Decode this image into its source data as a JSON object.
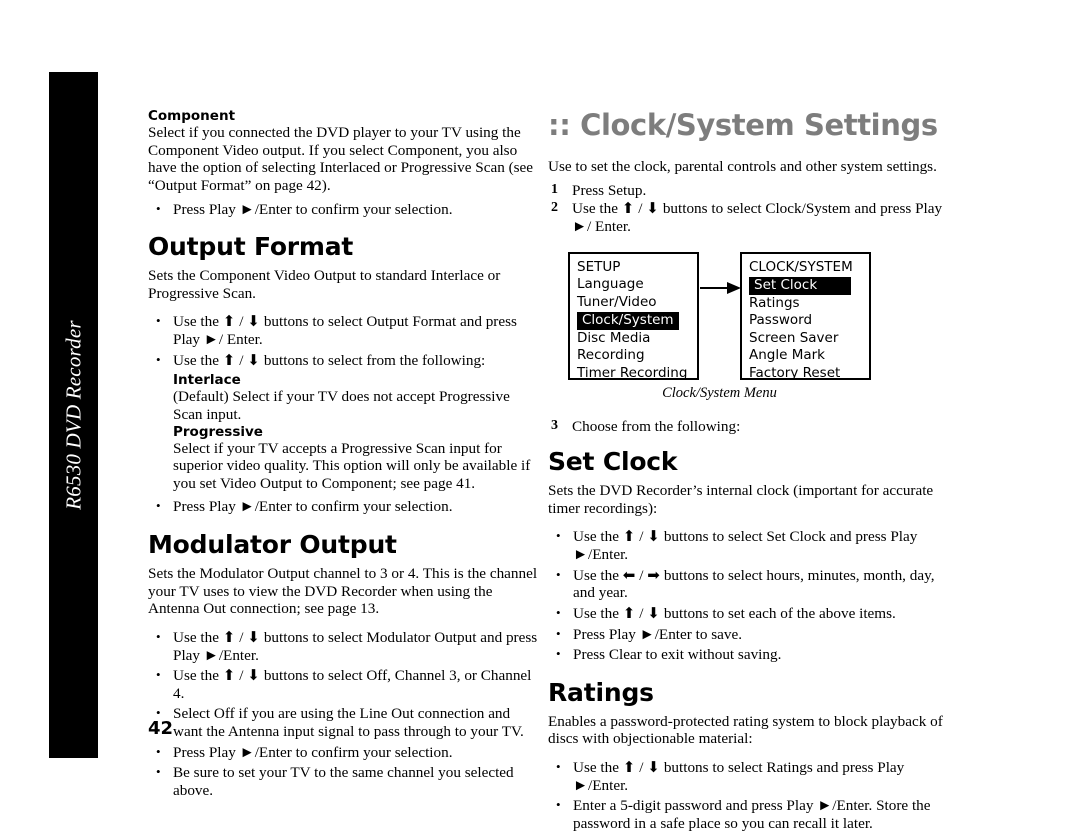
{
  "spine": {
    "label": "R6530 DVD Recorder"
  },
  "page_number": "42",
  "left_column": {
    "component": {
      "heading": "Component",
      "body": "Select if you connected the DVD player to your TV using the Component Video output. If you select Component, you also have the option of selecting Interlaced or Progressive Scan (see “Output Format” on page 42).",
      "bullets": [
        "Press Play ►/Enter to confirm your selection."
      ]
    },
    "output_format": {
      "heading": "Output Format",
      "body": "Sets the Component Video Output to standard Interlace or Progressive Scan.",
      "bullets": [
        "Use the ⬆ / ⬇ buttons to select Output Format and press Play ►/ Enter.",
        "Use the ⬆ / ⬇ buttons to select from the following:"
      ],
      "interlace": {
        "heading": "Interlace",
        "body": "(Default) Select if your TV does not accept Progressive Scan input."
      },
      "progressive": {
        "heading": "Progressive",
        "body": "Select if your TV accepts a Progressive Scan input for superior video quality. This option will only be available if you set Video Output to Component; see page 41."
      },
      "final_bullets": [
        "Press Play ►/Enter to confirm your selection."
      ]
    },
    "modulator_output": {
      "heading": "Modulator Output",
      "body": "Sets the Modulator Output channel to 3 or 4. This is the channel your TV uses to view the DVD Recorder when using the Antenna Out connection; see page 13.",
      "bullets": [
        "Use the ⬆ / ⬇ buttons to select Modulator Output and press Play ►/Enter.",
        "Use the ⬆ / ⬇ buttons to select Off, Channel 3, or Channel 4.",
        "Select Off if you are using the Line Out connection and  want the Antenna input signal to pass through to your TV.",
        "Press Play ►/Enter to confirm your selection.",
        "Be sure to set your TV to the same channel you selected above."
      ]
    }
  },
  "right_column": {
    "title_prefix": ":: ",
    "title": ":: Clock/System Settings",
    "intro": "Use to set the clock, parental controls and other system settings.",
    "steps": [
      {
        "num": "1",
        "text": "Press Setup."
      },
      {
        "num": "2",
        "text": "Use the ⬆ / ⬇ buttons to select Clock/System and press Play ►/ Enter."
      }
    ],
    "diagram": {
      "setup_menu": {
        "title": "SETUP",
        "items": [
          {
            "label": "Language",
            "selected": false
          },
          {
            "label": "Tuner/Video",
            "selected": false
          },
          {
            "label": "Clock/System",
            "selected": true
          },
          {
            "label": "Disc Media",
            "selected": false
          },
          {
            "label": "Recording",
            "selected": false
          },
          {
            "label": "Timer Recording",
            "selected": false
          }
        ]
      },
      "clock_system_menu": {
        "title": "CLOCK/SYSTEM",
        "items": [
          {
            "label": "Set Clock",
            "selected": true
          },
          {
            "label": "Ratings",
            "selected": false
          },
          {
            "label": "Password",
            "selected": false
          },
          {
            "label": "Screen Saver",
            "selected": false
          },
          {
            "label": "Angle Mark",
            "selected": false
          },
          {
            "label": "Factory Reset",
            "selected": false
          }
        ]
      },
      "caption": "Clock/System Menu"
    },
    "step3": {
      "num": "3",
      "text": "Choose from the following:"
    },
    "set_clock": {
      "heading": "Set Clock",
      "body": "Sets the DVD Recorder’s internal clock (important for accurate timer recordings):",
      "bullets": [
        "Use the ⬆ / ⬇ buttons to select Set Clock and press Play ►/Enter.",
        "Use the ⬅ / ➡ buttons to select hours, minutes, month, day, and year.",
        "Use the ⬆ / ⬇ buttons to set each of the above items.",
        "Press Play ►/Enter to save.",
        "Press Clear to exit without saving."
      ]
    },
    "ratings": {
      "heading": "Ratings",
      "body": "Enables a password-protected rating system to block playback of discs with objectionable material:",
      "bullets": [
        "Use the ⬆ / ⬇ buttons to select Ratings and press Play ►/Enter.",
        "Enter a 5-digit password and press Play ►/Enter. Store the password in a safe place so you can recall it later."
      ]
    }
  }
}
